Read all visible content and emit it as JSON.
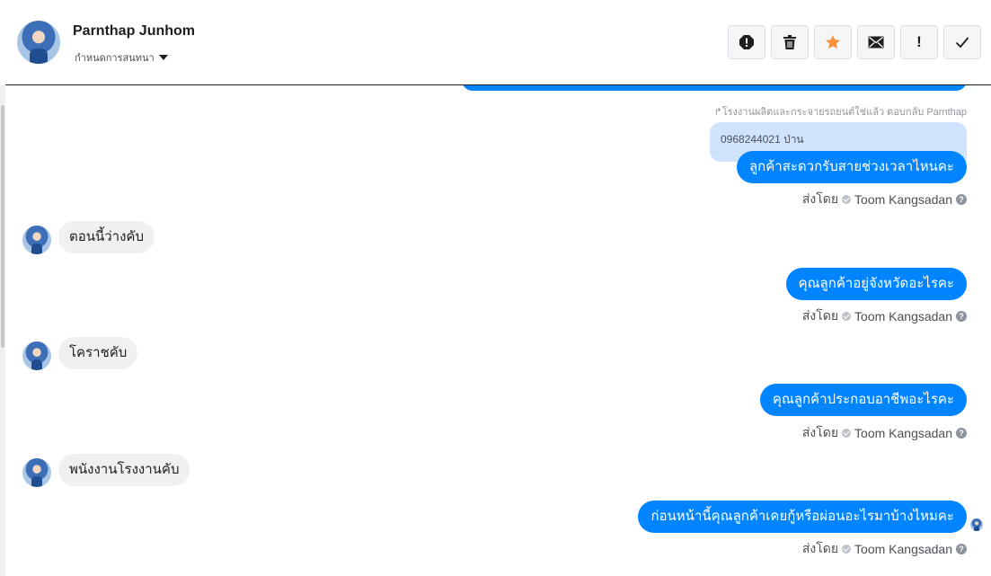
{
  "header": {
    "contact_name": "Parnthap Junhom",
    "conversation_settings": "กำหนดการสนทนา"
  },
  "toolbar": {
    "buttons": [
      {
        "name": "alert-icon",
        "color": "#1c1e21"
      },
      {
        "name": "trash-icon",
        "color": "#1c1e21"
      },
      {
        "name": "star-icon",
        "color": "#f7923b"
      },
      {
        "name": "mail-icon",
        "color": "#1c1e21"
      },
      {
        "name": "exclamation-icon",
        "label": "!",
        "color": "#1c1e21"
      },
      {
        "name": "check-icon",
        "color": "#1c1e21"
      }
    ]
  },
  "colors": {
    "outgoing_bubble": "#0084ff",
    "incoming_bubble": "#f1f0f0",
    "quoted_bubble": "#cfe3fd",
    "star": "#f7923b"
  },
  "messages": {
    "reply_note": "↱โรงงานผลิตและกระจายรถยนต์ใช่แล้ว ตอบกลับ Parnthap",
    "quoted_text": "0968244021 ป่าน",
    "m1": {
      "text": "ลูกค้าสะดวกรับสายช่วงเวลาไหนคะ",
      "sent_by_prefix": "ส่งโดย",
      "sender": "Toom Kangsadan"
    },
    "m2": {
      "text": "ตอนนี้ว่างคับ"
    },
    "m3": {
      "text": "คุณลูกค้าอยู่จังหวัดอะไรคะ",
      "sent_by_prefix": "ส่งโดย",
      "sender": "Toom Kangsadan"
    },
    "m4": {
      "text": "โคราชคับ"
    },
    "m5": {
      "text": "คุณลูกค้าประกอบอาชีพอะไรคะ",
      "sent_by_prefix": "ส่งโดย",
      "sender": "Toom Kangsadan"
    },
    "m6": {
      "text": "พนังงานโรงงานคับ"
    },
    "m7": {
      "text": "ก่อนหน้านี้คุณลูกค้าเคยกู้หรือผ่อนอะไรมาบ้างไหมคะ",
      "sent_by_prefix": "ส่งโดย",
      "sender": "Toom Kangsadan"
    },
    "help_label": "?"
  }
}
